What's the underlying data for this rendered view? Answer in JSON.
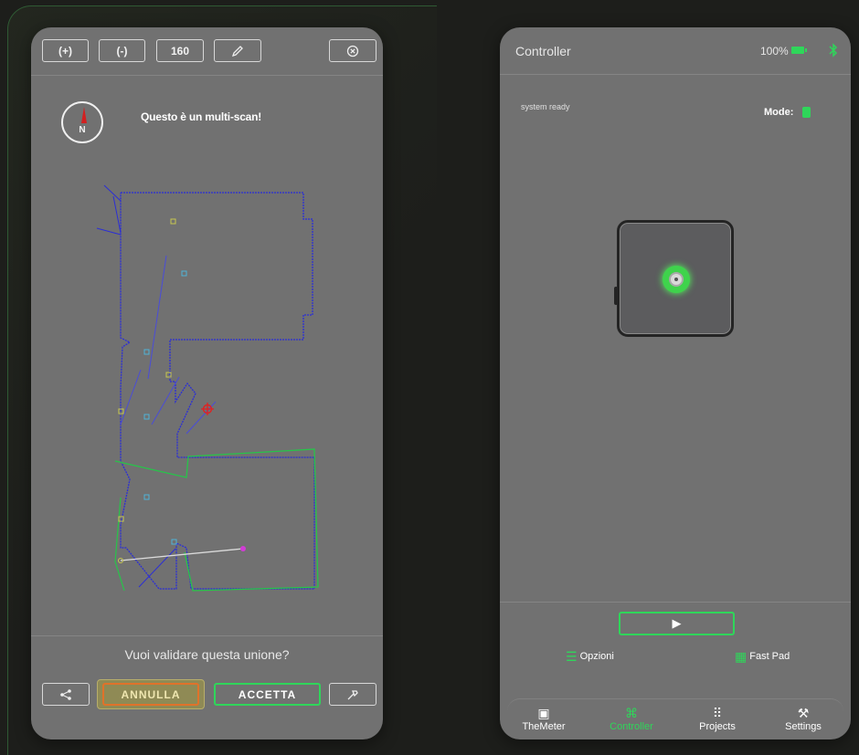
{
  "left_panel": {
    "toolbar": {
      "zoom_in": "(+)",
      "zoom_out": "(-)",
      "value": "160",
      "edit_icon": "pencil-icon",
      "close_icon": "close-circle-icon"
    },
    "compass": {
      "label": "N",
      "icon": "compass-icon"
    },
    "title": "Questo è un multi-scan!",
    "question": "Vuoi validare questa unione?",
    "buttons": {
      "share_icon": "share-icon",
      "cancel": "ANNULLA",
      "accept": "ACCETTA",
      "tools_icon": "hammer-icon"
    },
    "colors": {
      "scan_blue": "#2b2ed6",
      "scan_green": "#27c44a",
      "marker_red": "#e02222",
      "accept_border": "#2fd65a",
      "cancel_border": "#e0722a"
    }
  },
  "right_panel": {
    "header": {
      "title": "Controller",
      "battery": "100%",
      "battery_icon": "battery-icon",
      "bt_icon": "bluetooth-icon"
    },
    "status": "system ready",
    "mode_label": "Mode:",
    "play_icon": "play-icon",
    "play_symbol": "▶",
    "options": [
      {
        "label": "Opzioni",
        "icon": "sliders-icon",
        "symbol": "☰"
      },
      {
        "label": "Fast Pad",
        "icon": "grid-icon",
        "symbol": "▦"
      }
    ],
    "nav": [
      {
        "label": "TheMeter",
        "icon": "meter-icon",
        "symbol": "▣",
        "active": false
      },
      {
        "label": "Controller",
        "icon": "gamepad-icon",
        "symbol": "⌘",
        "active": true
      },
      {
        "label": "Projects",
        "icon": "dots-grid-icon",
        "symbol": "⠿",
        "active": false
      },
      {
        "label": "Settings",
        "icon": "tools-icon",
        "symbol": "⚒",
        "active": false
      }
    ],
    "colors": {
      "accent": "#2fd65a"
    }
  }
}
